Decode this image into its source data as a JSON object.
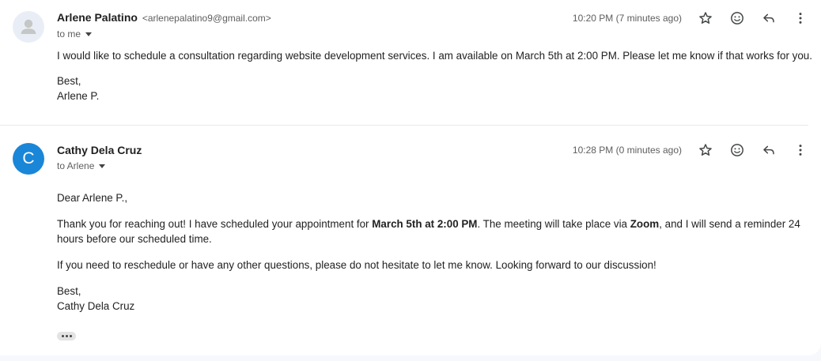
{
  "messages": [
    {
      "sender_name": "Arlene Palatino",
      "sender_email": "<arlenepalatino9@gmail.com>",
      "recipient": "to me",
      "timestamp": "10:20 PM (7 minutes ago)",
      "avatar_icon": "person-icon",
      "body_paragraph": "I would like to schedule a consultation regarding website development services. I am available on March 5th at 2:00 PM. Please let me know if that works for you.",
      "signoff": "Best,",
      "signature": "Arlene P."
    },
    {
      "sender_name": "Cathy Dela Cruz",
      "recipient": "to Arlene",
      "timestamp": "10:28 PM (0 minutes ago)",
      "avatar_letter": "C",
      "avatar_color": "#1a86d8",
      "greeting": "Dear Arlene P.,",
      "para1_a": "Thank you for reaching out! I have scheduled your appointment for ",
      "para1_b": "March 5th at 2:00 PM",
      "para1_c": ". The meeting will take place via ",
      "para1_d": "Zoom",
      "para1_e": ", and I will send a reminder 24 hours before our scheduled time.",
      "para2": "If you need to reschedule or have any other questions, please do not hesitate to let me know. Looking forward to our discussion!",
      "signoff": "Best,",
      "signature": "Cathy Dela Cruz"
    }
  ],
  "actions": {
    "star_icon": "star-icon",
    "emoji_icon": "emoji-reaction-icon",
    "reply_icon": "reply-icon",
    "more_icon": "more-vert-icon"
  },
  "show_trimmed_icon": "ellipsis-icon"
}
